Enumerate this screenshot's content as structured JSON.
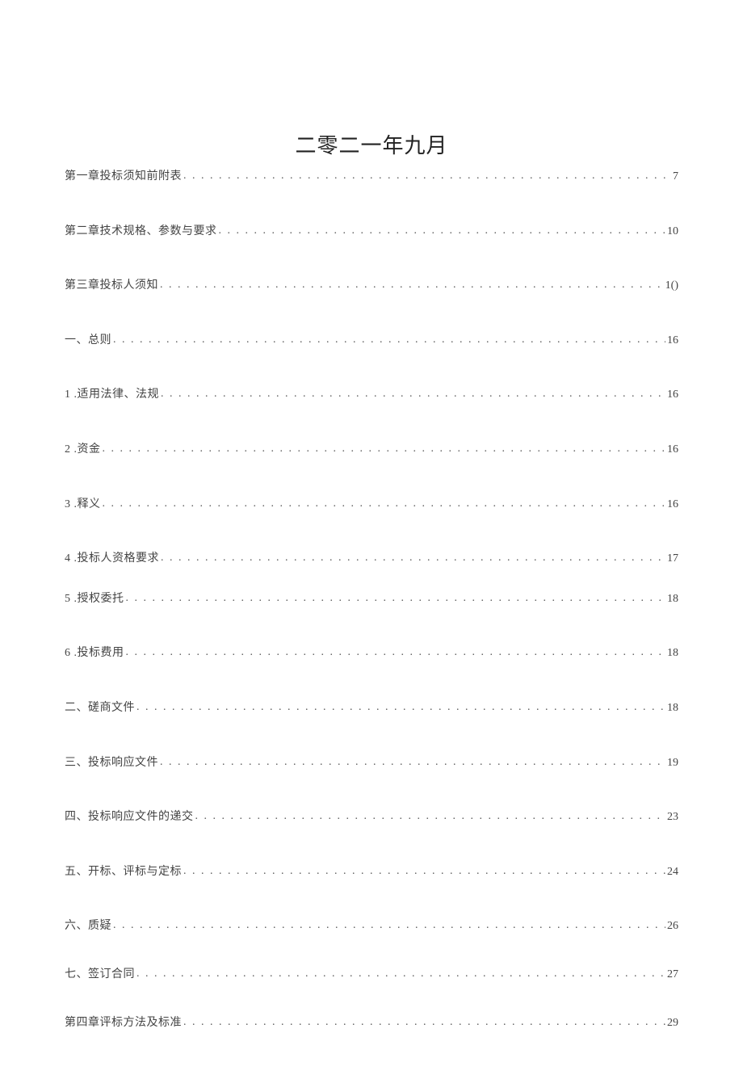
{
  "title": "二零二一年九月",
  "toc": [
    {
      "label": "第一章投标须知前附表",
      "page": "7",
      "gap": "gap-first"
    },
    {
      "label": "第二章技术规格、参数与要求",
      "page": "10",
      "gap": "gap-lg"
    },
    {
      "label": "第三章投标人须知 ",
      "page": "1()",
      "gap": "gap-lg"
    },
    {
      "label": "一、总则",
      "page": "16",
      "gap": "gap-lg"
    },
    {
      "label": "1  .适用法律、法规",
      "page": "16",
      "gap": "gap-lg"
    },
    {
      "label": "2   .资金 ",
      "page": " 16",
      "gap": "gap-lg"
    },
    {
      "label": "3   .释义 ",
      "page": " 16",
      "gap": "gap-lg"
    },
    {
      "label": "4   .投标人资格要求 ",
      "page": " 17",
      "gap": "gap-lg"
    },
    {
      "label": "5    .授权委托",
      "page": " 18",
      "gap": "gap-sm"
    },
    {
      "label": "6   .投标费用 ",
      "page": " 18",
      "gap": "gap-lg"
    },
    {
      "label": "二、磋商文件",
      "page": " 18",
      "gap": "gap-lg"
    },
    {
      "label": "三、投标响应文件",
      "page": " 19",
      "gap": "gap-lg"
    },
    {
      "label": "四、投标响应文件的递交",
      "page": " 23",
      "gap": "gap-lg"
    },
    {
      "label": "五、开标、评标与定标",
      "page": " 24",
      "gap": "gap-lg"
    },
    {
      "label": "六、质疑",
      "page": " 26",
      "gap": "gap-lg"
    },
    {
      "label": "七、签订合同",
      "page": " 27",
      "gap": "gap-md"
    },
    {
      "label": "第四章评标方法及标准",
      "page": " 29",
      "gap": "gap-md"
    }
  ]
}
